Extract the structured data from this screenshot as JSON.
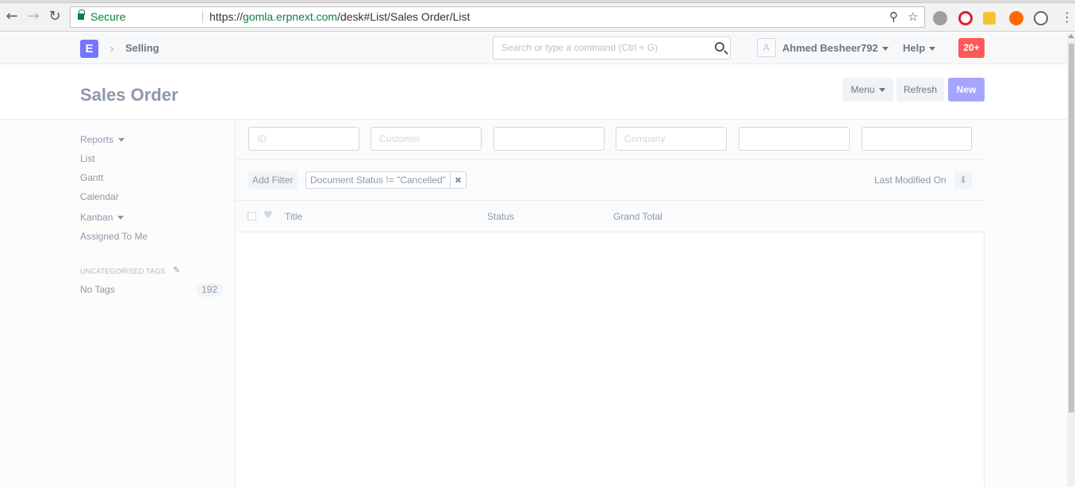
{
  "browser": {
    "secure_label": "Secure",
    "url_prefix": "https://",
    "url_host": "gomla.erpnext.com",
    "url_path": "/desk#List/Sales Order/List"
  },
  "navbar": {
    "logo_letter": "E",
    "breadcrumb": "Selling",
    "search_placeholder": "Search or type a command (Ctrl + G)",
    "avatar_letter": "A",
    "user_name": "Ahmed Besheer792",
    "help_label": "Help",
    "notification_count": "20+"
  },
  "page": {
    "title": "Sales Order",
    "menu_label": "Menu",
    "refresh_label": "Refresh",
    "new_label": "New"
  },
  "sidebar": {
    "reports": "Reports",
    "list": "List",
    "gantt": "Gantt",
    "calendar": "Calendar",
    "kanban": "Kanban",
    "assigned": "Assigned To Me",
    "tags_heading": "UNCATEGORISED TAGS",
    "no_tags": "No Tags",
    "no_tags_count": "192"
  },
  "filters": {
    "id_placeholder": "ID",
    "customer_placeholder": "Customer",
    "field3_placeholder": "",
    "company_placeholder": "Company",
    "field5_placeholder": "",
    "field6_placeholder": ""
  },
  "filterbar": {
    "add_filter": "Add Filter",
    "active_filter": "Document Status != \"Cancelled\"",
    "sort_label": "Last Modified On"
  },
  "columns": {
    "title": "Title",
    "status": "Status",
    "grand_total": "Grand Total"
  }
}
